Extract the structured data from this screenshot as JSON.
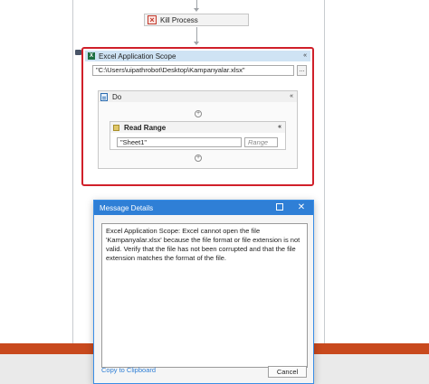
{
  "workflow": {
    "kill_process": {
      "label": "Kill Process"
    },
    "excel_scope": {
      "title": "Excel Application Scope",
      "workbook_path": "\"C:\\Users\\uipathrobot\\Desktop\\Kampanyalar.xlsx\"",
      "browse_label": "...",
      "collapse_glyph": "«",
      "do": {
        "title": "Do",
        "collapse_glyph": "«",
        "read_range": {
          "title": "Read Range",
          "collapse_glyph": "«",
          "sheet_value": "\"Sheet1\"",
          "range_placeholder": "Range"
        }
      }
    }
  },
  "dialog": {
    "title": "Message Details",
    "message": "Excel Application Scope: Excel cannot open the file 'Kampanyalar.xlsx' because the file format or file extension is not valid. Verify that the file has not been corrupted and that the file extension matches the format of the file.",
    "copy_link": "Copy to Clipboard",
    "cancel_label": "Cancel",
    "close_glyph": "✕"
  },
  "colors": {
    "selection_border": "#d0202a",
    "dialog_titlebar": "#2f7fd6",
    "scope_header": "#cfe3f4",
    "status_bar": "#c8491d"
  }
}
